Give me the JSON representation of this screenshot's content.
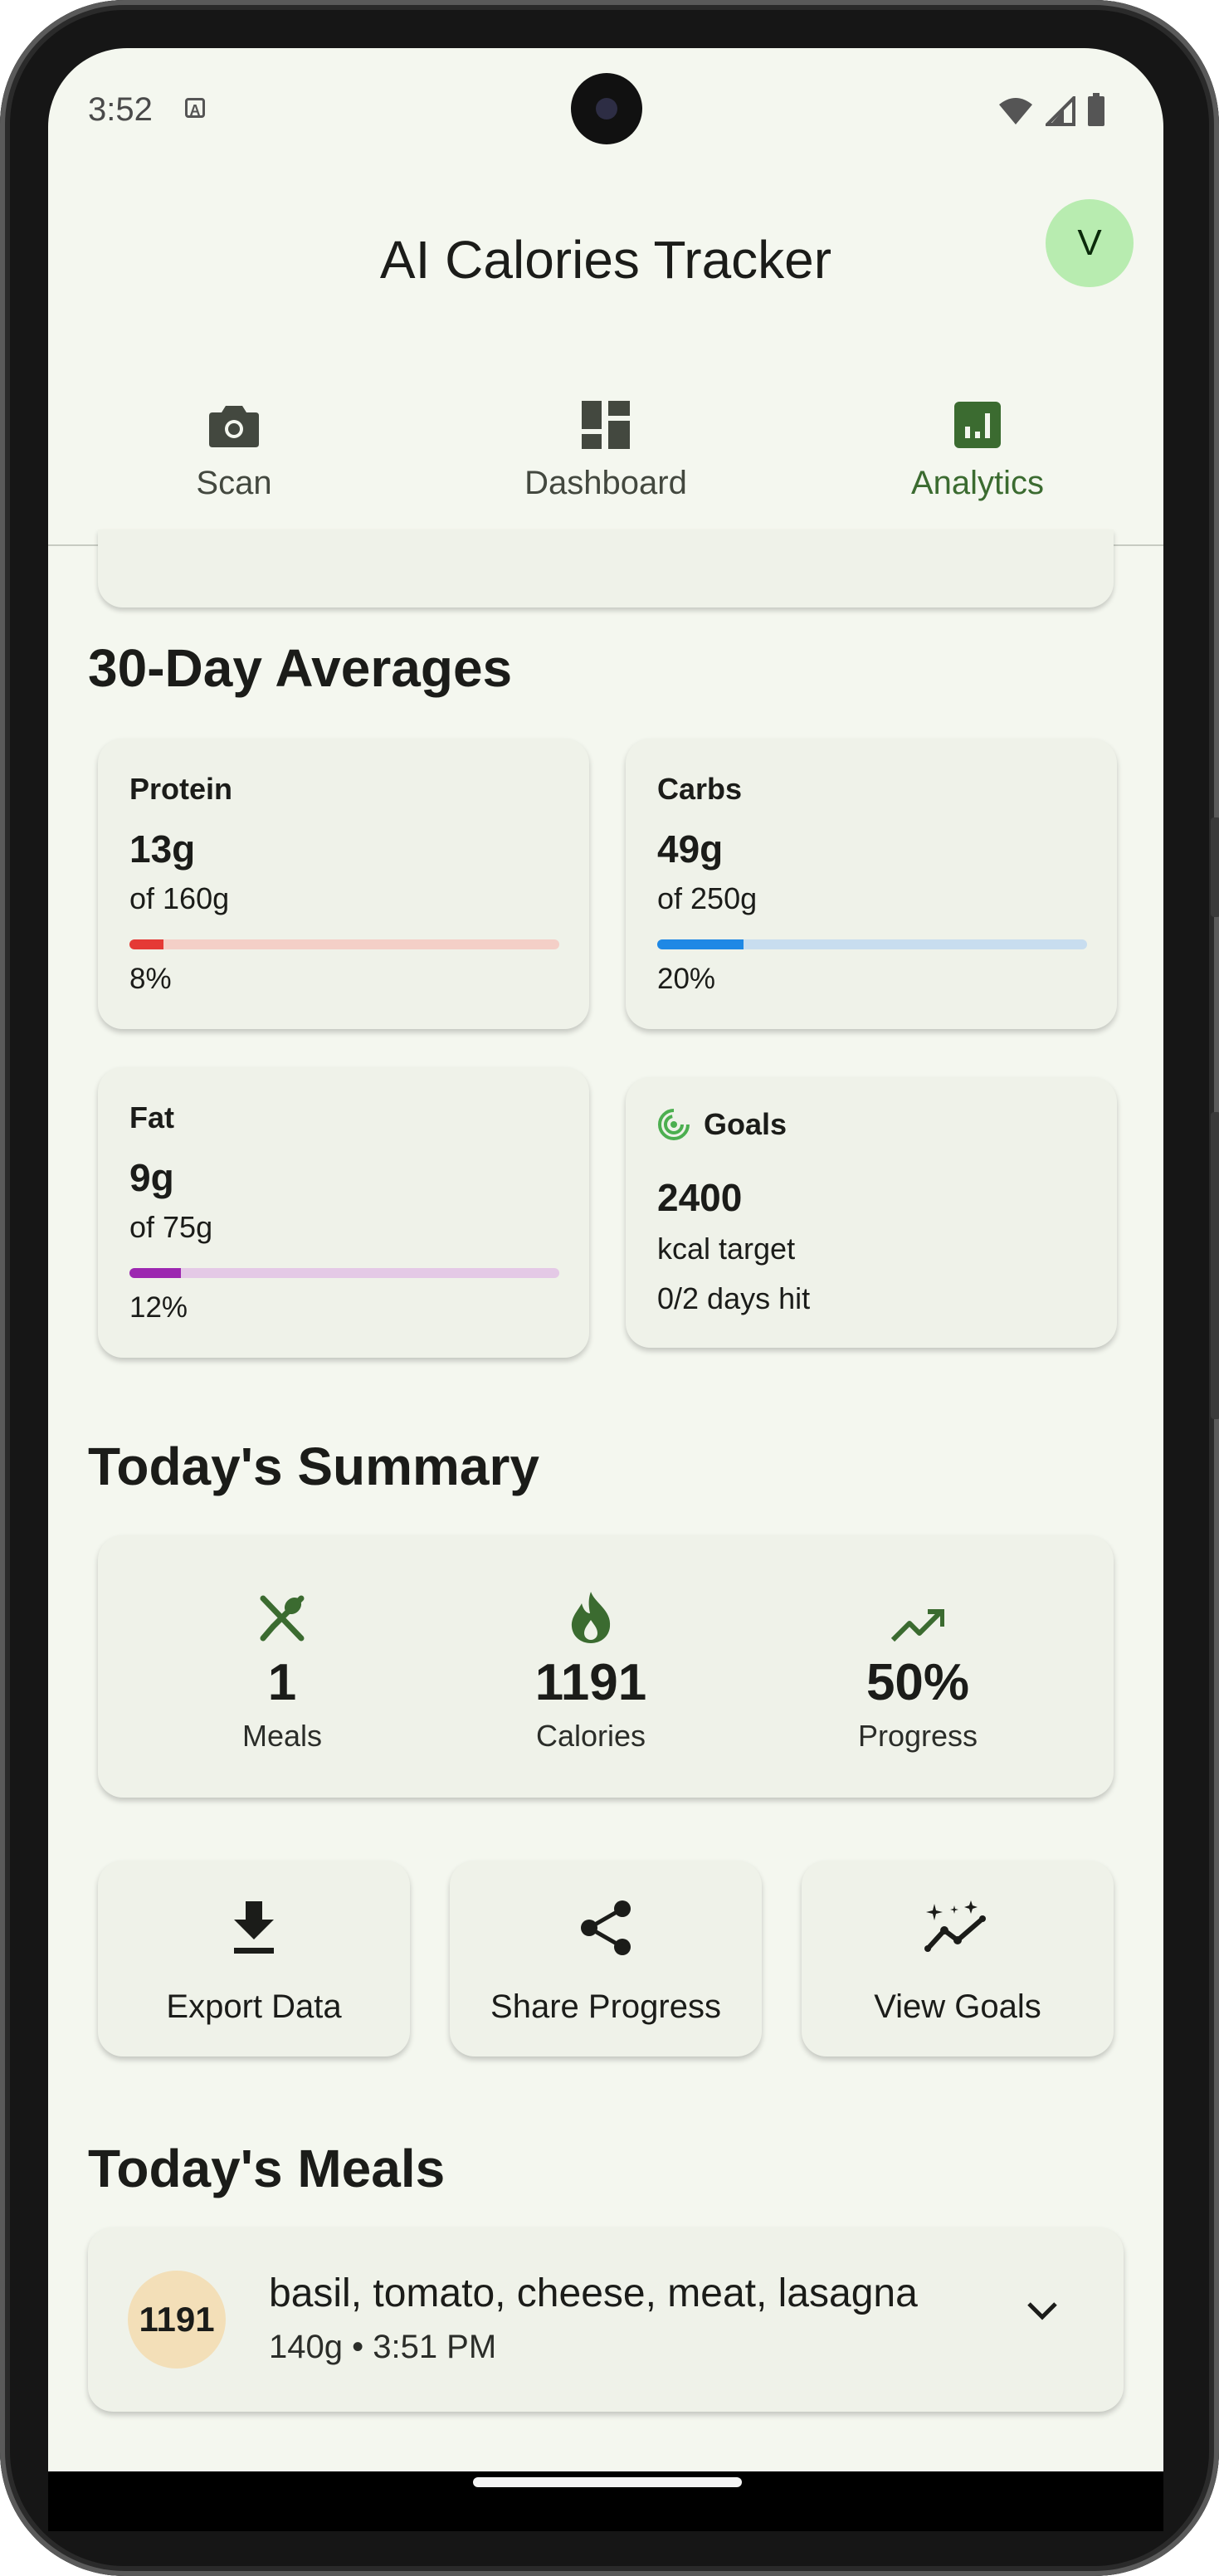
{
  "status_bar": {
    "time": "3:52",
    "notif_icon": "a-icon"
  },
  "header": {
    "title": "AI Calories Tracker",
    "avatar_initial": "V"
  },
  "tabs": [
    {
      "label": "Scan",
      "icon": "camera-icon"
    },
    {
      "label": "Dashboard",
      "icon": "dashboard-icon"
    },
    {
      "label": "Analytics",
      "icon": "analytics-icon",
      "active": true
    }
  ],
  "averages": {
    "title": "30-Day Averages",
    "protein": {
      "label": "Protein",
      "value": "13g",
      "target": "of 160g",
      "percent_label": "8%",
      "percent": 8,
      "color": "#e53935",
      "track": "#f4cfc7"
    },
    "carbs": {
      "label": "Carbs",
      "value": "49g",
      "target": "of 250g",
      "percent_label": "20%",
      "percent": 20,
      "color": "#1e88e5",
      "track": "#c8ddef"
    },
    "fat": {
      "label": "Fat",
      "value": "9g",
      "target": "of 75g",
      "percent_label": "12%",
      "percent": 12,
      "color": "#9c27b0",
      "track": "#e4c9e6"
    },
    "goals": {
      "label": "Goals",
      "value": "2400",
      "unit": "kcal target",
      "days": "0/2 days hit",
      "icon": "target-icon"
    }
  },
  "summary": {
    "title": "Today's Summary",
    "items": [
      {
        "value": "1",
        "label": "Meals",
        "icon": "utensils-icon"
      },
      {
        "value": "1191",
        "label": "Calories",
        "icon": "flame-icon"
      },
      {
        "value": "50%",
        "label": "Progress",
        "icon": "trending-up-icon"
      }
    ]
  },
  "actions": [
    {
      "label": "Export Data",
      "icon": "download-icon"
    },
    {
      "label": "Share Progress",
      "icon": "share-icon"
    },
    {
      "label": "View Goals",
      "icon": "sparkle-chart-icon"
    }
  ],
  "meals": {
    "title": "Today's Meals",
    "items": [
      {
        "calories": "1191",
        "name": "basil, tomato, cheese, meat, lasagna",
        "meta": "140g • 3:51 PM"
      }
    ]
  },
  "colors": {
    "accent": "#3b6b30",
    "background": "#f4f7ef",
    "card": "#eff2e9"
  }
}
